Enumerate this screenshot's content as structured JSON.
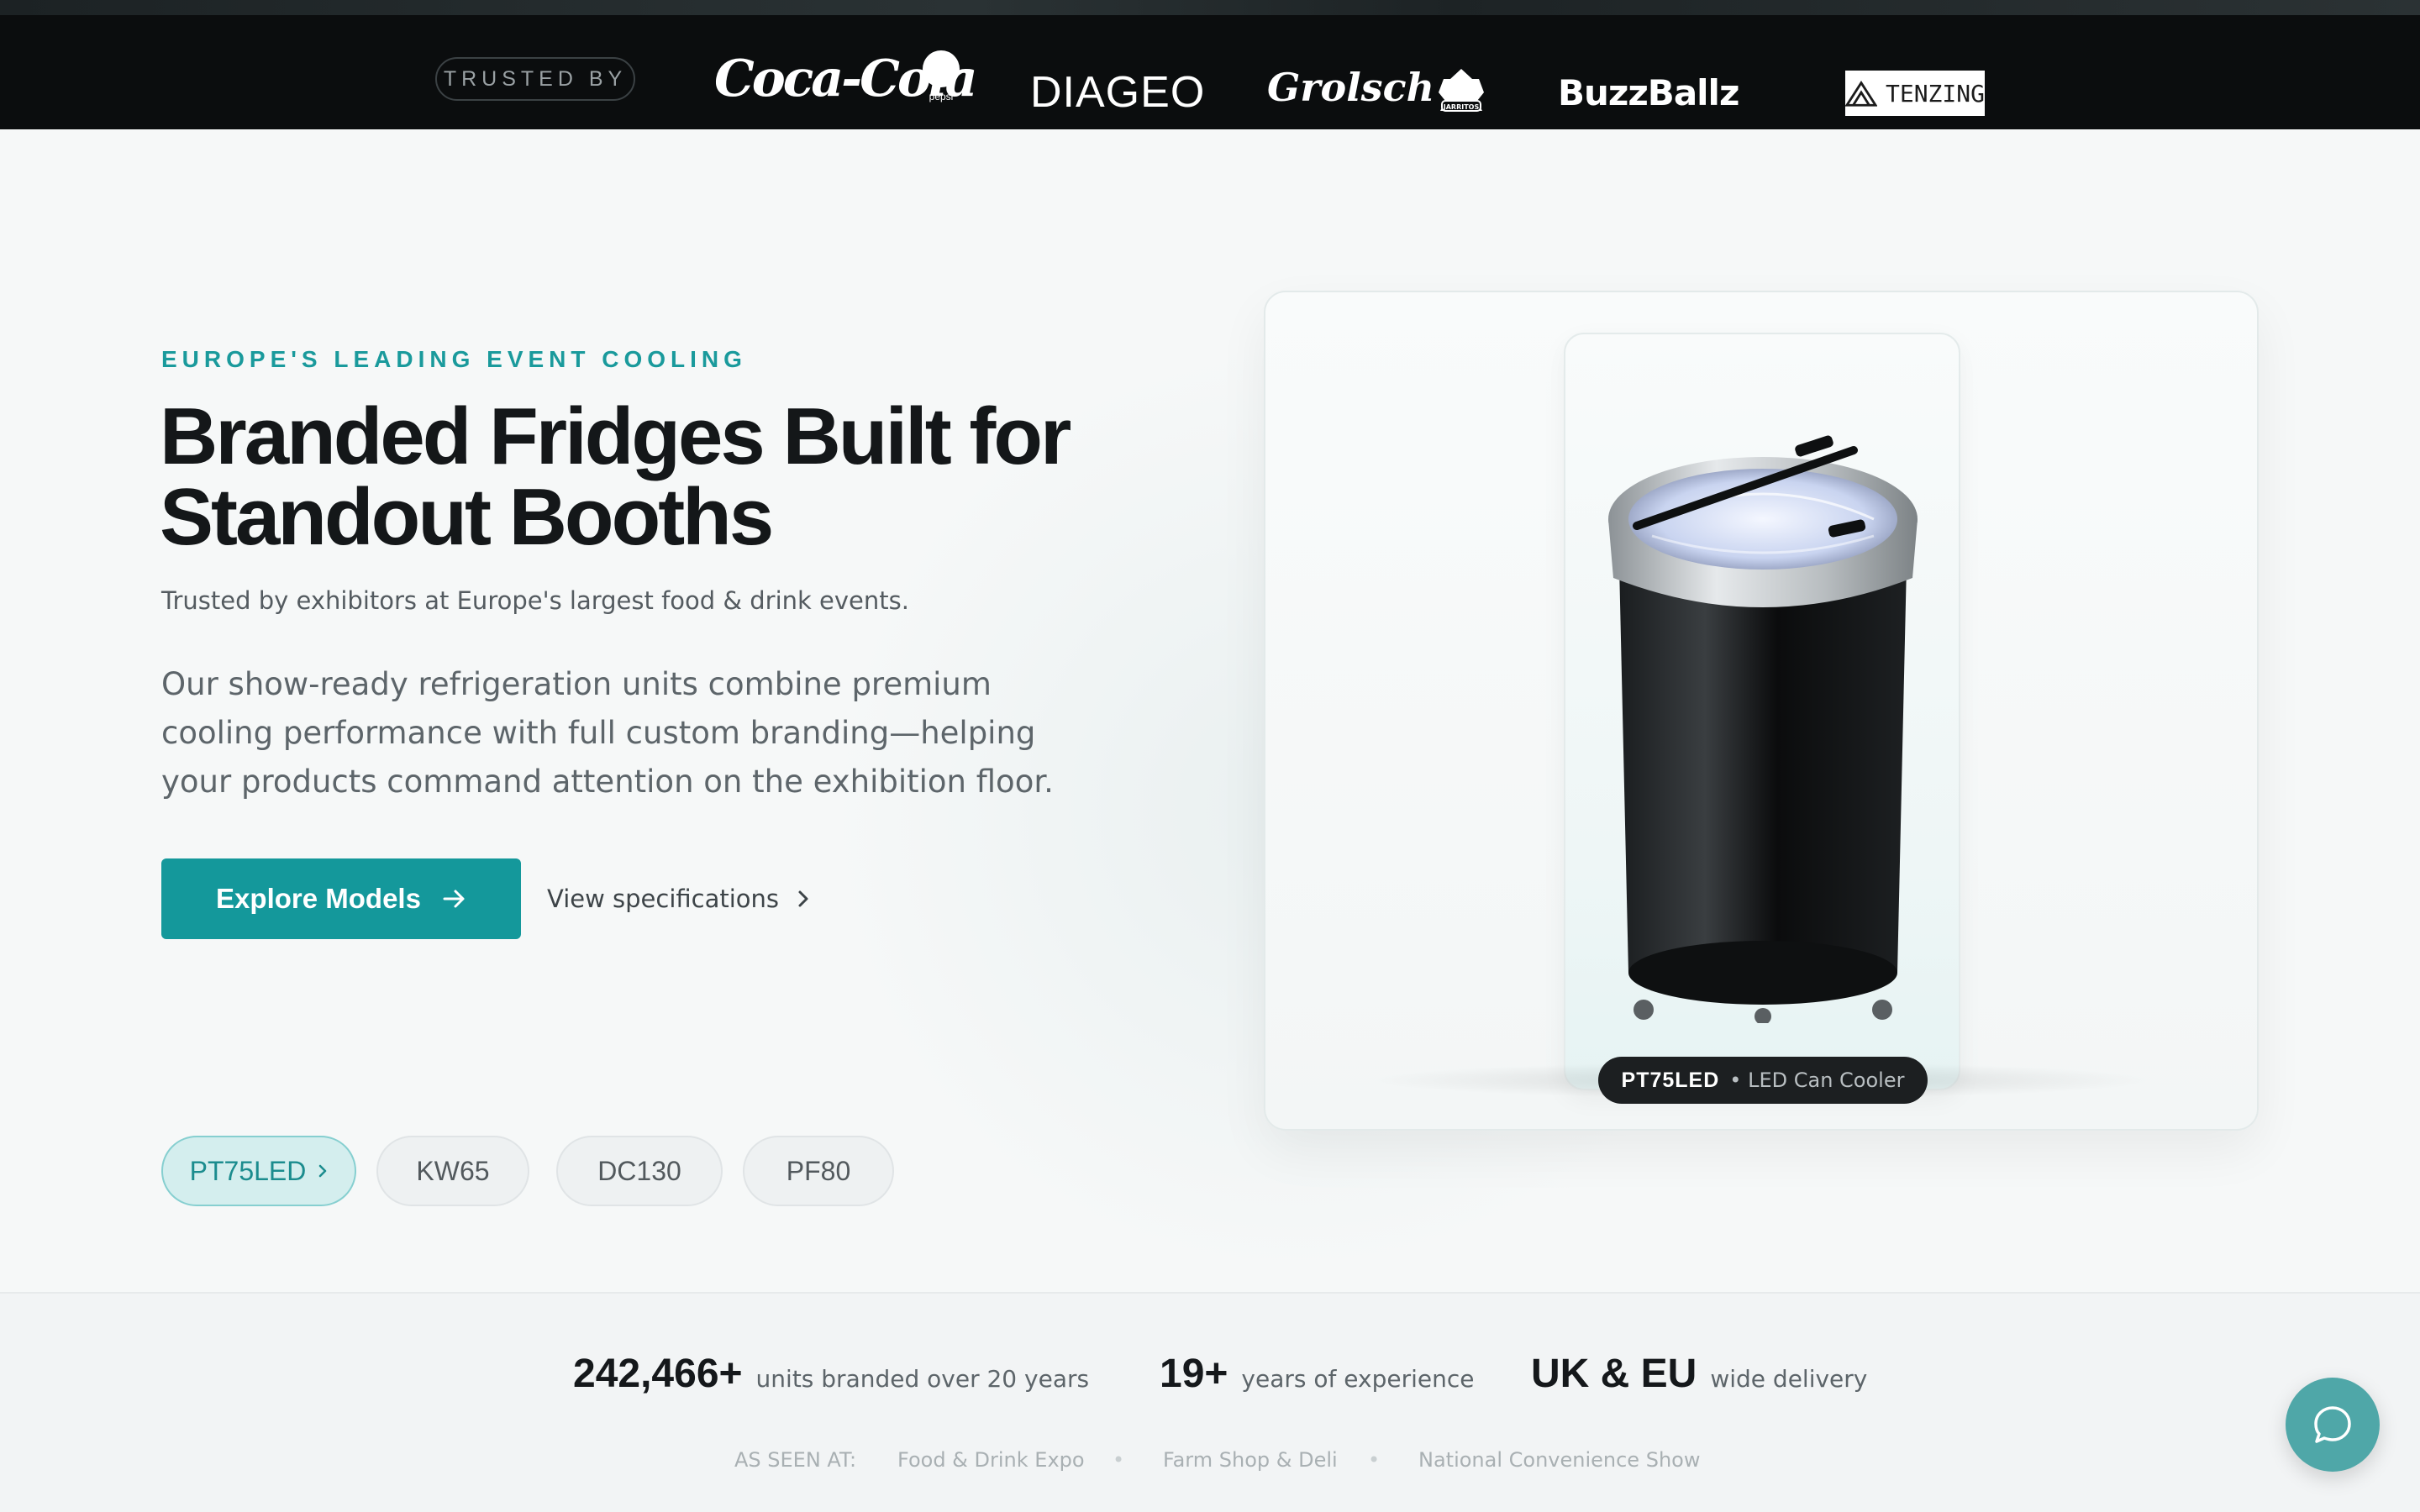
{
  "trusted_bar": {
    "label": "TRUSTED BY",
    "logos": [
      "Coca-Cola",
      "pepsi",
      "DIAGEO",
      "Grolsch",
      "JARRITOS",
      "BuzzBallz",
      "TENZING"
    ]
  },
  "hero": {
    "eyebrow": "EUROPE'S LEADING EVENT COOLING",
    "headline_line1": "Branded Fridges Built for",
    "headline_line2": "Standout Booths",
    "subline": "Trusted by exhibitors at Europe's largest food & drink events.",
    "lead": "Our show-ready refrigeration units combine premium cooling performance with full custom branding—helping your products command attention on the exhibition floor.",
    "primary_button": "Explore Models",
    "secondary_link": "View specifications",
    "models": [
      {
        "label": "PT75LED",
        "active": true
      },
      {
        "label": "KW65",
        "active": false
      },
      {
        "label": "DC130",
        "active": false
      },
      {
        "label": "PF80",
        "active": false
      }
    ]
  },
  "product_card": {
    "model": "PT75LED",
    "description": "• LED Can Cooler"
  },
  "stats": [
    {
      "value": "242,466+",
      "label": "units branded over 20 years"
    },
    {
      "value": "19+",
      "label": "years of experience"
    },
    {
      "value": "UK & EU",
      "label": "wide delivery"
    }
  ],
  "as_seen_at": {
    "label": "AS SEEN AT:",
    "events": [
      "Food & Drink Expo",
      "Farm Shop & Deli",
      "National Convenience Show"
    ]
  },
  "colors": {
    "accent": "#14989B",
    "dark_bar": "#0B0D0E",
    "background": "#F6F8F8"
  },
  "icons": [
    "arrow-right-icon",
    "chevron-right-icon",
    "chat-bubble-icon"
  ]
}
